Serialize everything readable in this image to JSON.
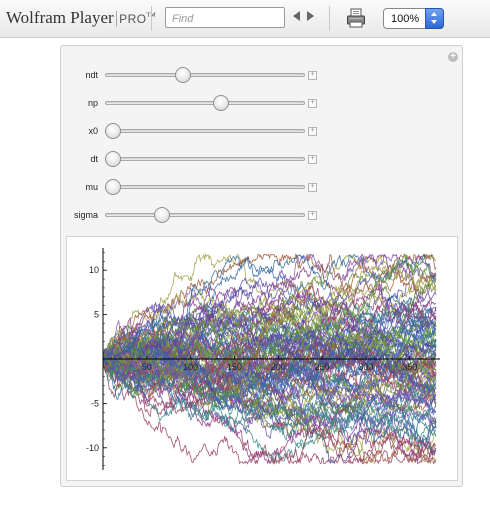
{
  "toolbar": {
    "brand_name": "Wolfram Player",
    "brand_separator": "|",
    "brand_edition": "PRO",
    "brand_tm": "TM",
    "find_placeholder": "Find",
    "zoom_value": "100%",
    "icons": {
      "back": "left-arrow-icon",
      "forward": "right-arrow-icon",
      "print": "printer-icon",
      "zoom_stepper": "stepper-icon",
      "add": "plus-icon"
    }
  },
  "controls": [
    {
      "label": "ndt",
      "value": 0.38
    },
    {
      "label": "np",
      "value": 0.585
    },
    {
      "label": "x0",
      "value": 0.0
    },
    {
      "label": "dt",
      "value": 0.0
    },
    {
      "label": "mu",
      "value": 0.0
    },
    {
      "label": "sigma",
      "value": 0.265
    }
  ],
  "chart_data": {
    "type": "line",
    "title": "",
    "xlabel": "",
    "ylabel": "",
    "xlim": [
      0,
      380
    ],
    "ylim": [
      -12.5,
      12.5
    ],
    "x_ticks": [
      50,
      100,
      150,
      200,
      250,
      300,
      350
    ],
    "y_ticks": [
      10,
      5,
      -5,
      -10
    ],
    "x_tick_labels": [
      "50",
      "100",
      "150",
      "200",
      "250",
      "300",
      "350"
    ],
    "y_tick_labels": [
      "10",
      "5",
      "-5",
      "-10"
    ],
    "steps": 380,
    "num_paths": 100,
    "start_value": 0,
    "grid": false,
    "legend": "none",
    "colors": [
      "#5b4fa8",
      "#8b3f8f",
      "#3e6bb0",
      "#5c8a3c",
      "#a05c3a",
      "#3a8a8a",
      "#a3a34a",
      "#7a5ab0",
      "#2f6a9a",
      "#9a4060",
      "#6a9a40",
      "#4a4aa0"
    ]
  }
}
